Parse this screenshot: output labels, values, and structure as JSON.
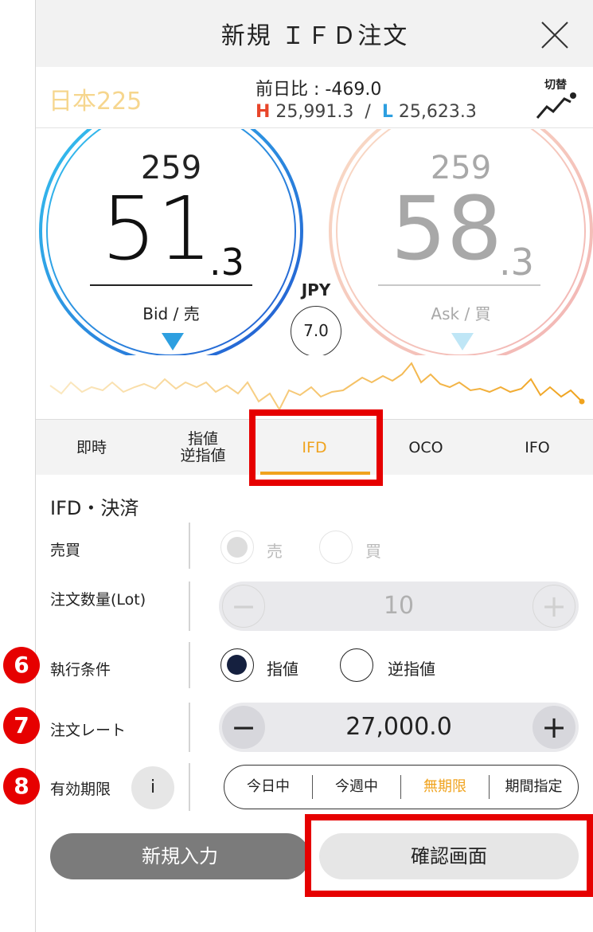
{
  "header": {
    "title": "新規 ＩＦＤ注文"
  },
  "instrument": {
    "name": "日本225",
    "diff_label": "前日比 : -469.0",
    "high_tag": "H",
    "high_value": "25,991.3",
    "hl_sep": "/",
    "low_tag": "L",
    "low_value": "25,623.3",
    "switch_label": "切替"
  },
  "prices": {
    "bid": {
      "small": "259",
      "big": "51",
      "dec": ".3",
      "label": "Bid / 売"
    },
    "ask": {
      "small": "259",
      "big": "58",
      "dec": ".3",
      "label": "Ask / 買"
    },
    "currency": "JPY",
    "spread": "7.0"
  },
  "tabs": [
    {
      "label": "即時"
    },
    {
      "label": "指値\n逆指値"
    },
    {
      "label": "IFD"
    },
    {
      "label": "OCO"
    },
    {
      "label": "IFO"
    }
  ],
  "form": {
    "section_title": "IFD・決済",
    "side": {
      "label": "売買",
      "options": [
        "売",
        "買"
      ],
      "selected": "売"
    },
    "quantity": {
      "label": "注文数量(Lot)",
      "value": "10",
      "minus": "−",
      "plus": "+"
    },
    "exec_condition": {
      "label": "執行条件",
      "options": [
        "指値",
        "逆指値"
      ],
      "selected": "指値"
    },
    "rate": {
      "label": "注文レート",
      "value": "27,000.0",
      "minus": "−",
      "plus": "+"
    },
    "expiry": {
      "label": "有効期限",
      "info": "i",
      "options": [
        "今日中",
        "今週中",
        "無期限",
        "期間指定"
      ],
      "selected": "無期限"
    }
  },
  "buttons": {
    "new_input": "新規入力",
    "confirm": "確認画面"
  },
  "badges": [
    "6",
    "7",
    "8"
  ],
  "colors": {
    "accent": "#f0a31e",
    "highlight": "#e60000",
    "bid": "#2d9fe0",
    "ask": "#f3b3a8"
  }
}
